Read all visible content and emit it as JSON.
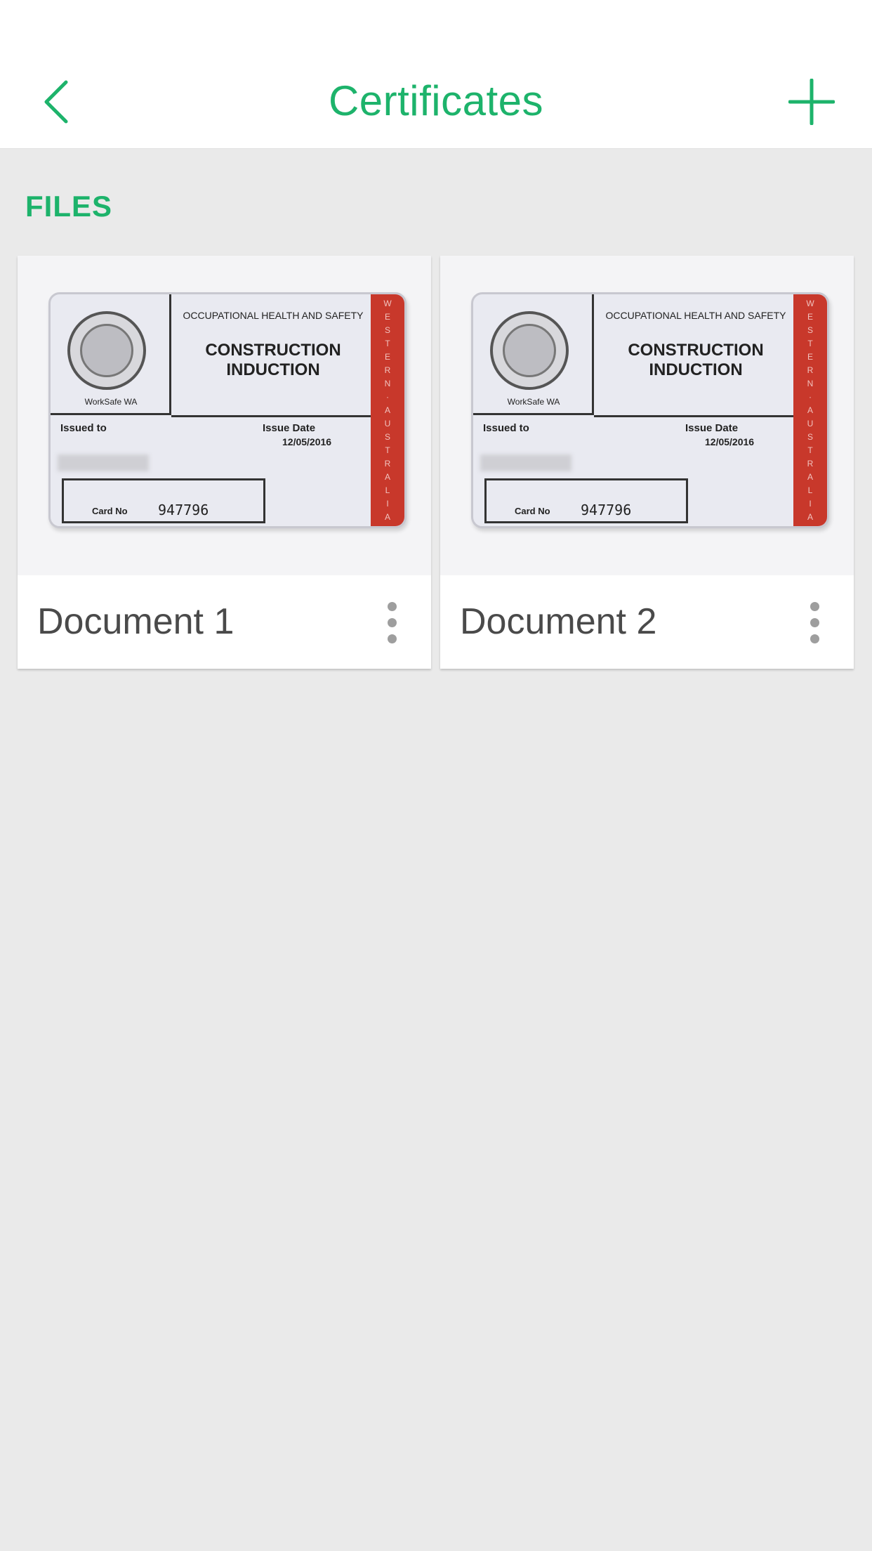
{
  "colors": {
    "accent": "#1db36b",
    "background": "#eaeaea",
    "header_bg": "#ffffff",
    "card_bg": "#ffffff",
    "text_dark": "#4a4a4a",
    "dots": "#9e9e9e"
  },
  "header": {
    "title": "Certificates",
    "back_icon": "chevron-left-icon",
    "add_icon": "plus-icon"
  },
  "section": {
    "label": "FILES"
  },
  "files": [
    {
      "title": "Document 1",
      "menu_icon": "more-vertical-icon",
      "thumbnail": {
        "header": "OCCUPATIONAL HEALTH AND SAFETY",
        "title_line1": "CONSTRUCTION",
        "title_line2": "INDUCTION",
        "seal_caption": "WorkSafe WA",
        "issued_label": "Issued to",
        "issue_date_label": "Issue Date",
        "issue_date": "12/05/2016",
        "card_no_label": "Card No",
        "card_no": "947796"
      }
    },
    {
      "title": "Document 2",
      "menu_icon": "more-vertical-icon",
      "thumbnail": {
        "header": "OCCUPATIONAL HEALTH AND SAFETY",
        "title_line1": "CONSTRUCTION",
        "title_line2": "INDUCTION",
        "seal_caption": "WorkSafe WA",
        "issued_label": "Issued to",
        "issue_date_label": "Issue Date",
        "issue_date": "12/05/2016",
        "card_no_label": "Card No",
        "card_no": "947796"
      }
    }
  ]
}
